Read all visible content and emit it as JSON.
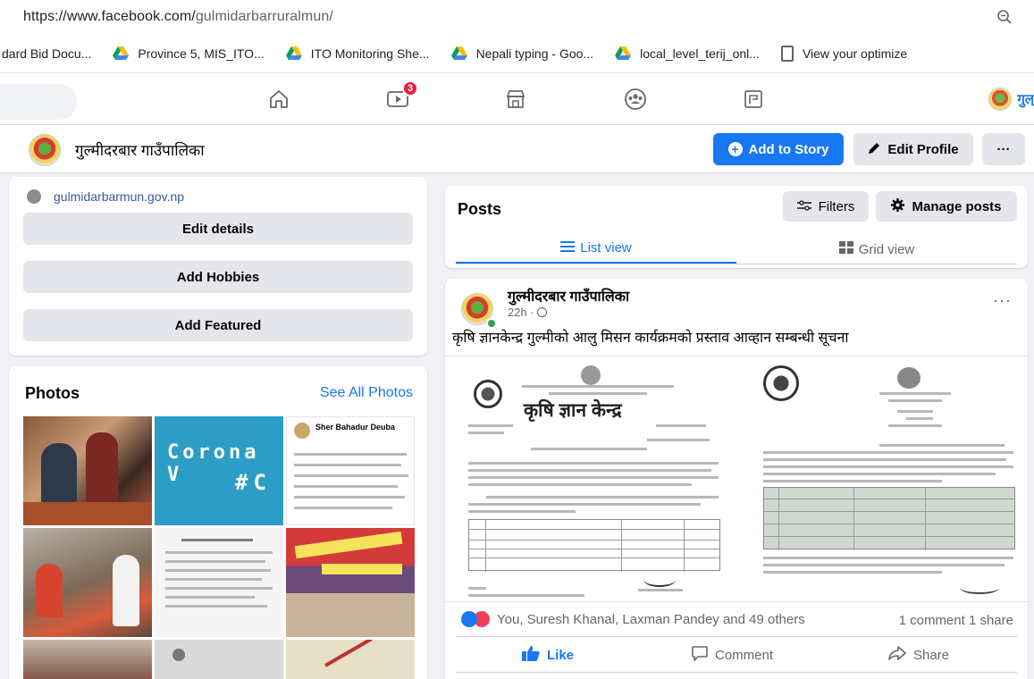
{
  "browser": {
    "url_main": "https://www.facebook.com/",
    "url_path": "gulmidarbarruralmun/",
    "bookmarks": [
      {
        "label": "dard Bid Docu...",
        "icon": "none"
      },
      {
        "label": "Province 5, MIS_ITO...",
        "icon": "google-drive-icon"
      },
      {
        "label": "ITO Monitoring She...",
        "icon": "google-drive-icon"
      },
      {
        "label": "Nepali typing - Goo...",
        "icon": "google-drive-icon"
      },
      {
        "label": "local_level_terij_onl...",
        "icon": "google-drive-icon"
      },
      {
        "label": "View your optimize",
        "icon": "document-icon"
      }
    ]
  },
  "nav": {
    "video_badge": "3",
    "profile_short": "गुल्"
  },
  "page": {
    "name": "गुल्मीदरबार गाउँपालिका",
    "add_story": "Add to Story",
    "edit_profile": "Edit Profile",
    "more": "···"
  },
  "intro": {
    "website": "gulmidarbarmun.gov.np",
    "edit_details": "Edit details",
    "add_hobbies": "Add Hobbies",
    "add_featured": "Add Featured"
  },
  "photos": {
    "title": "Photos",
    "see_all": "See All Photos",
    "thumb2_text_line1": "Corona V",
    "thumb2_text_line2": "#C",
    "thumb3_author": "Sher Bahadur Deuba"
  },
  "posts": {
    "title": "Posts",
    "filters": "Filters",
    "manage": "Manage posts",
    "list_view": "List view",
    "grid_view": "Grid view"
  },
  "post": {
    "author": "गुल्मीदरबार गाउँपालिका",
    "time": "22h ·",
    "caption": "कृषि ज्ञानकेन्द्र गुल्मीको आलु मिसन कार्यक्रमको प्रस्ताव आव्हान सम्बन्धी सूचना",
    "doc_heading": "कृषि ज्ञान केन्द्र",
    "reactions": "You, Suresh Khanal, Laxman Pandey and 49 others",
    "stats": "1 comment  1 share",
    "like": "Like",
    "comment": "Comment",
    "share": "Share",
    "colors": {
      "accent": "#1877f2",
      "heart": "#f33e58"
    }
  }
}
